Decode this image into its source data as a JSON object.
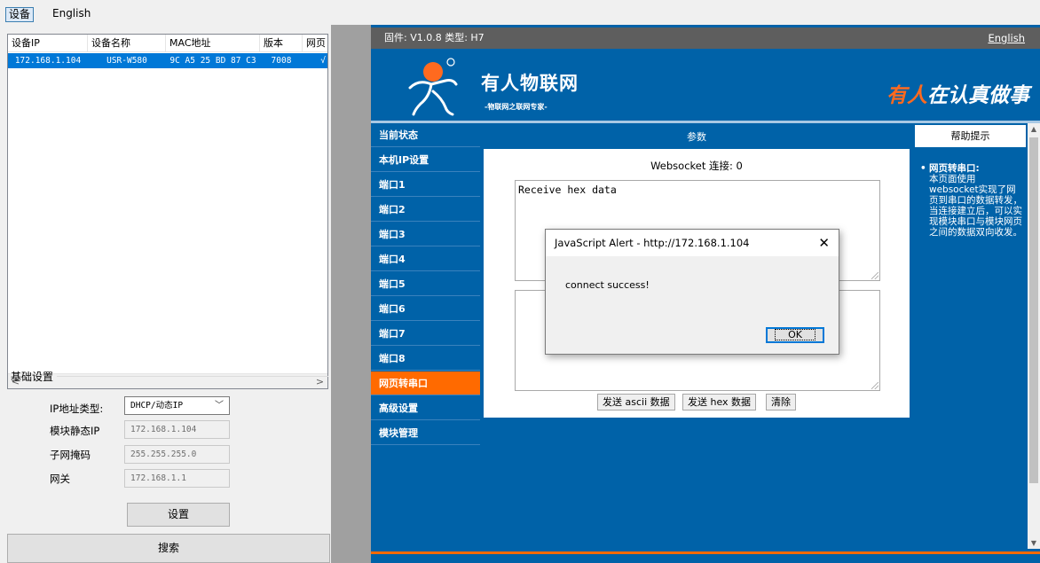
{
  "tabs": [
    "设备",
    "English"
  ],
  "device_list": {
    "columns": [
      "设备IP",
      "设备名称",
      "MAC地址",
      "版本",
      "网页"
    ],
    "rows": [
      {
        "ip": "172.168.1.104",
        "name": "USR-W580",
        "mac": "9C A5 25 BD 87 C3",
        "version": "7008",
        "web": "√"
      }
    ]
  },
  "basic_settings": {
    "title": "基础设置",
    "ip_type_label": "IP地址类型:",
    "ip_type_value": "DHCP/动态IP",
    "static_ip_label": "模块静态IP",
    "static_ip_value": "172.168.1.104",
    "subnet_label": "子网掩码",
    "subnet_value": "255.255.255.0",
    "gateway_label": "网关",
    "gateway_value": "172.168.1.1",
    "set_button": "设置",
    "search_button": "搜索"
  },
  "web": {
    "firmware": "固件: V1.0.8 类型: H7",
    "lang_link": "English",
    "brand_name": "有人物联网",
    "brand_sub": "-物联网之联网专家-",
    "slogan_highlight": "有人",
    "slogan_rest": "在认真做事",
    "nav": [
      "当前状态",
      "本机IP设置",
      "端口1",
      "端口2",
      "端口3",
      "端口4",
      "端口5",
      "端口6",
      "端口7",
      "端口8",
      "网页转串口",
      "高级设置",
      "模块管理"
    ],
    "active_nav": 10,
    "content_title": "参数",
    "ws_status": "Websocket 连接: 0",
    "receive_text": "Receive hex data",
    "btn_send_ascii": "发送 ascii 数据",
    "btn_send_hex": "发送 hex 数据",
    "btn_clear": "清除",
    "help_title": "帮助提示",
    "help_item_title": "网页转串口:",
    "help_item_text": "本页面使用websocket实现了网页到串口的数据转发，当连接建立后，可以实现模块串口与模块网页之间的数据双向收发。"
  },
  "alert": {
    "title": "JavaScript Alert - http://172.168.1.104",
    "message": "connect success!",
    "ok": "OK"
  },
  "colors": {
    "brand_blue": "#0062a8",
    "accent_orange": "#ff6a00",
    "selection_blue": "#0078d7"
  }
}
